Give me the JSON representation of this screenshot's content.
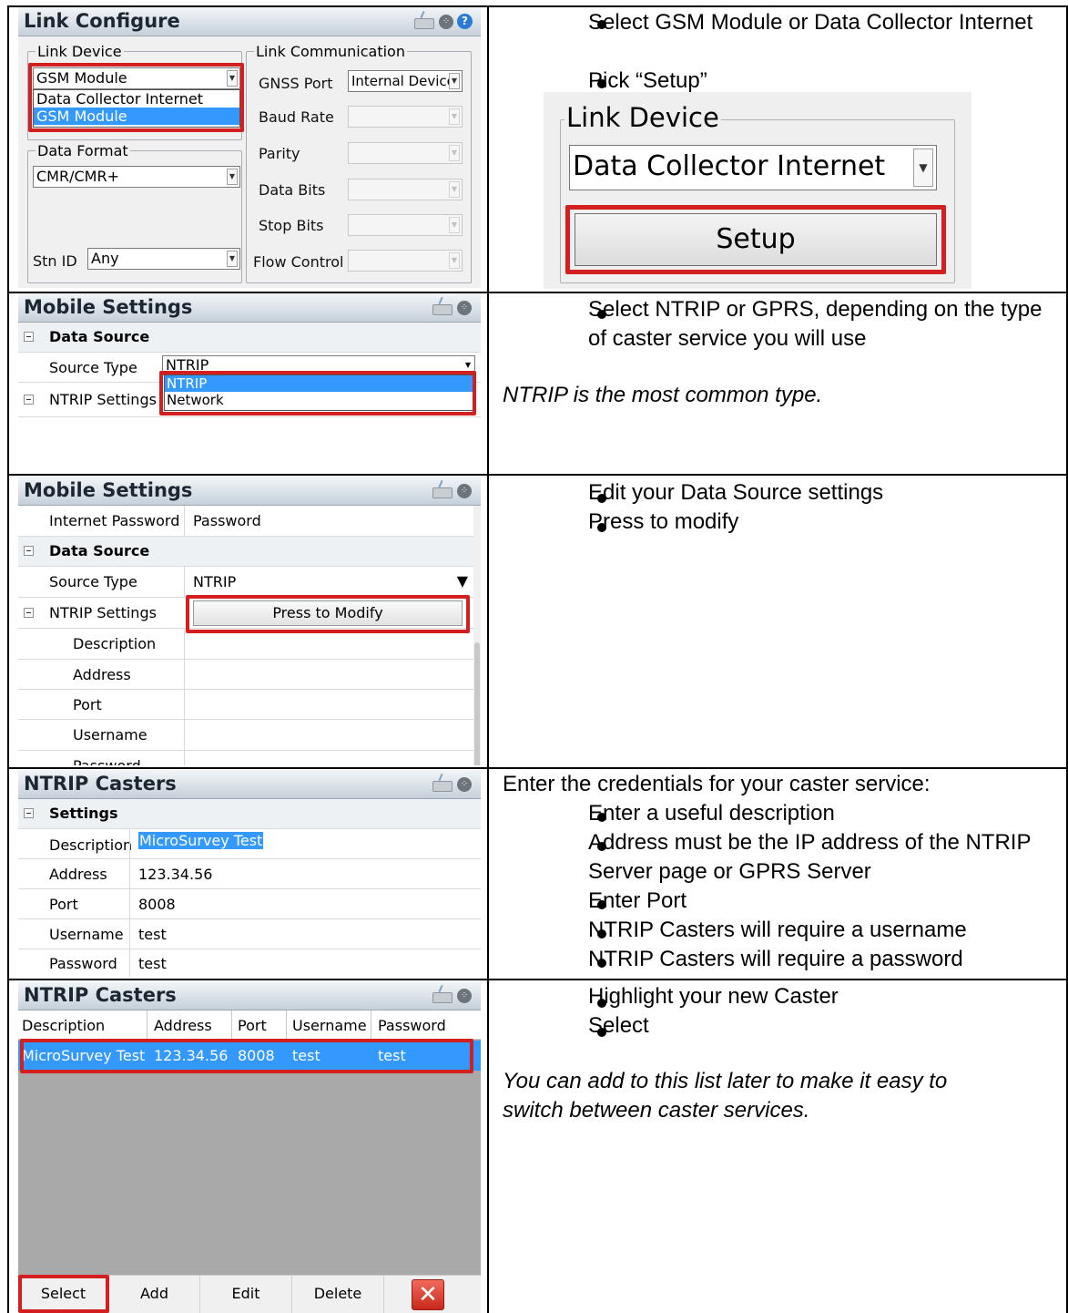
{
  "rows": [
    {
      "screen": {
        "title": "Link Configure",
        "link_device_label": "Link Device",
        "link_device_value": "GSM Module",
        "dropdown_options": [
          "Data Collector Internet",
          "GSM Module"
        ],
        "data_format_label": "Data Format",
        "data_format_value": "CMR/CMR+",
        "stn_id_label": "Stn ID",
        "stn_id_value": "Any",
        "link_comm_label": "Link Communication",
        "gnss_port_label": "GNSS Port",
        "gnss_port_value": "Internal Device",
        "baud_rate_label": "Baud Rate",
        "parity_label": "Parity",
        "data_bits_label": "Data Bits",
        "stop_bits_label": "Stop Bits",
        "flow_control_label": "Flow Control"
      },
      "zoom": {
        "group_label": "Link Device",
        "select_value": "Data Collector Internet",
        "setup_button": "Setup"
      },
      "bullets": [
        "Select GSM Module or Data Collector Internet",
        "Pick “Setup”"
      ]
    },
    {
      "screen": {
        "title": "Mobile Settings",
        "section": "Data Source",
        "source_type_label": "Source Type",
        "source_type_value": "NTRIP",
        "ntrip_settings_label": "NTRIP Settings",
        "dropdown_options": [
          "NTRIP",
          "Network"
        ]
      },
      "bullets": [
        "Select NTRIP or GPRS, depending on the type of caster service you will use"
      ],
      "note": "NTRIP is the most common type."
    },
    {
      "screen": {
        "title": "Mobile Settings",
        "internet_password_label": "Internet Password",
        "internet_password_value": "Password",
        "section": "Data Source",
        "source_type_label": "Source Type",
        "source_type_value": "NTRIP",
        "ntrip_settings_label": "NTRIP Settings",
        "modify_button": "Press to Modify",
        "fields": [
          "Description",
          "Address",
          "Port",
          "Username",
          "Password"
        ]
      },
      "bullets": [
        "Edit your Data Source settings",
        "Press to modify"
      ]
    },
    {
      "screen": {
        "title": "NTRIP Casters",
        "section": "Settings",
        "fields": [
          {
            "label": "Description",
            "value": "MicroSurvey Test"
          },
          {
            "label": "Address",
            "value": "123.34.56"
          },
          {
            "label": "Port",
            "value": "8008"
          },
          {
            "label": "Username",
            "value": "test"
          },
          {
            "label": "Password",
            "value": "test"
          }
        ]
      },
      "intro": "Enter the credentials for your caster service:",
      "bullets": [
        "Enter a useful description",
        "Address must be the IP address of the NTRIP Server page or GPRS Server",
        "Enter Port",
        "NTRIP Casters will require a username",
        "NTRIP Casters will require a password"
      ]
    },
    {
      "screen": {
        "title": "NTRIP Casters",
        "columns": [
          "Description",
          "Address",
          "Port",
          "Username",
          "Password"
        ],
        "row": [
          "MicroSurvey Test",
          "123.34.56",
          "8008",
          "test",
          "test"
        ],
        "buttons": [
          "Select",
          "Add",
          "Edit",
          "Delete"
        ]
      },
      "bullets": [
        "Highlight your new Caster",
        "Select"
      ],
      "note": "You can add to this list later to make it easy to switch between caster services."
    }
  ]
}
